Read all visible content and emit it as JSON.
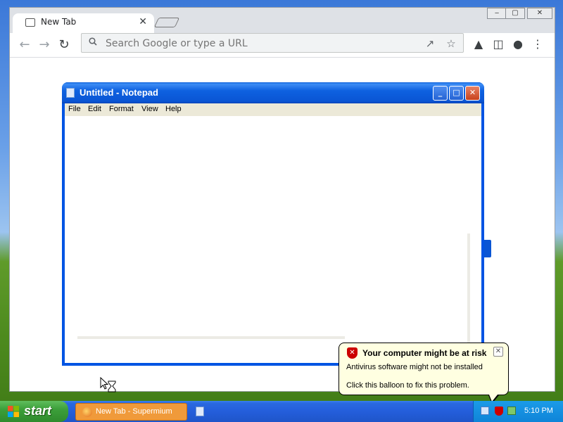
{
  "browser": {
    "tab_title": "New Tab",
    "tab_close": "✕",
    "omnibox_placeholder": "Search Google or type a URL",
    "window_controls": {
      "minimize": "‒",
      "maximize": "▢",
      "close": "✕"
    }
  },
  "notepad": {
    "title": "Untitled - Notepad",
    "menu": [
      "File",
      "Edit",
      "Format",
      "View",
      "Help"
    ],
    "controls": {
      "minimize": "_",
      "maximize": "□",
      "close": "✕"
    }
  },
  "balloon": {
    "title": "Your computer might be at risk",
    "line1": "Antivirus software might not be installed",
    "line2": "Click this balloon to fix this problem.",
    "close": "✕"
  },
  "taskbar": {
    "start_label": "start",
    "task_label": "New Tab - Supermium",
    "clock": "5:10 PM"
  },
  "icons": [
    "search-icon",
    "share-icon",
    "star-icon",
    "extensions-icon",
    "sidepanel-icon",
    "profile-icon",
    "menu-icon",
    "back-icon",
    "forward-icon",
    "reload-icon",
    "notepad-icon",
    "security-shield-icon",
    "windows-flag-icon",
    "supermium-icon"
  ]
}
